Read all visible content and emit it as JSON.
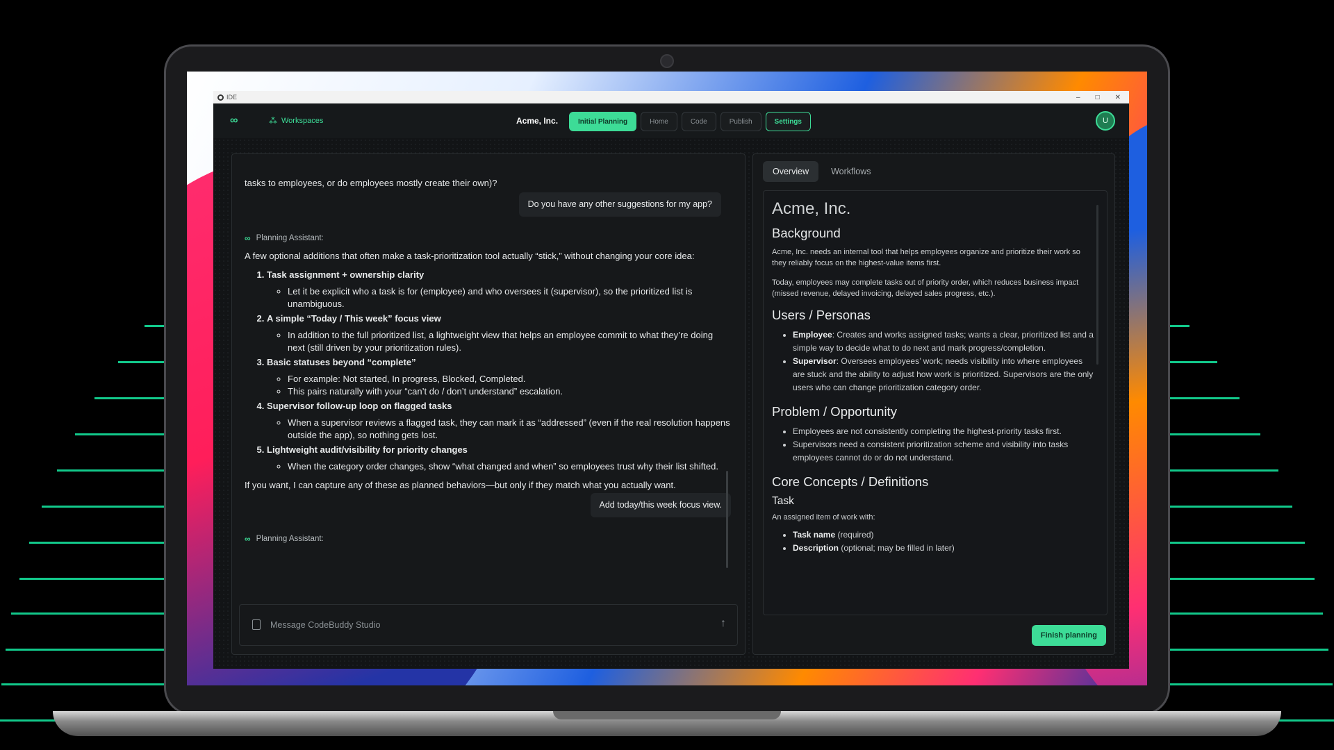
{
  "window": {
    "title": "IDE",
    "controls": [
      "–",
      "□",
      "✕"
    ]
  },
  "appbar": {
    "workspaces_label": "Workspaces",
    "company": "Acme, Inc.",
    "tabs": [
      {
        "label": "Initial Planning"
      },
      {
        "label": "Home"
      },
      {
        "label": "Code"
      },
      {
        "label": "Publish"
      },
      {
        "label": "Settings"
      }
    ],
    "avatar_initial": "U"
  },
  "chat": {
    "top_text": "tasks to employees, or do employees mostly create their own)?",
    "user_message_1": "Do you have any other suggestions for my app?",
    "assistant_label": "Planning Assistant:",
    "intro": "A few optional additions that often make a task-prioritization tool actually “stick,” without changing your core idea:",
    "suggestions": [
      {
        "title": "Task assignment + ownership clarity",
        "bullets": [
          "Let it be explicit who a task is for (employee) and who oversees it (supervisor), so the prioritized list is unambiguous."
        ]
      },
      {
        "title": "A simple “Today / This week” focus view",
        "bullets": [
          "In addition to the full prioritized list, a lightweight view that helps an employee commit to what they’re doing next (still driven by your prioritization rules)."
        ]
      },
      {
        "title": "Basic statuses beyond “complete”",
        "bullets": [
          "For example: Not started, In progress, Blocked, Completed.",
          "This pairs naturally with your “can’t do / don’t understand” escalation."
        ]
      },
      {
        "title": "Supervisor follow-up loop on flagged tasks",
        "bullets": [
          "When a supervisor reviews a flagged task, they can mark it as “addressed” (even if the real resolution happens outside the app), so nothing gets lost."
        ]
      },
      {
        "title": "Lightweight audit/visibility for priority changes",
        "bullets": [
          "When the category order changes, show “what changed and when” so employees trust why their list shifted."
        ]
      }
    ],
    "outro": "If you want, I can capture any of these as planned behaviors—but only if they match what you actually want.",
    "user_message_2": "Add today/this week focus view.",
    "assistant_label_2": "Planning Assistant:",
    "input_placeholder": "Message CodeBuddy Studio"
  },
  "panel": {
    "tabs": [
      {
        "label": "Overview"
      },
      {
        "label": "Workflows"
      }
    ],
    "doc": {
      "title": "Acme, Inc.",
      "background_heading": "Background",
      "background_p1": "Acme, Inc. needs an internal tool that helps employees organize and prioritize their work so they reliably focus on the highest-value items first.",
      "background_p2": "Today, employees may complete tasks out of priority order, which reduces business impact (missed revenue, delayed invoicing, delayed sales progress, etc.).",
      "users_heading": "Users / Personas",
      "personas": [
        {
          "name": "Employee",
          "text": ": Creates and works assigned tasks; wants a clear, prioritized list and a simple way to decide what to do next and mark progress/completion."
        },
        {
          "name": "Supervisor",
          "text": ": Oversees employees’ work; needs visibility into where employees are stuck and the ability to adjust how work is prioritized. Supervisors are the only users who can change prioritization category order."
        }
      ],
      "problem_heading": "Problem / Opportunity",
      "problems": [
        "Employees are not consistently completing the highest-priority tasks first.",
        "Supervisors need a consistent prioritization scheme and visibility into tasks employees cannot do or do not understand."
      ],
      "concepts_heading": "Core Concepts / Definitions",
      "task_heading": "Task",
      "task_desc": "An assigned item of work with:",
      "task_fields": [
        {
          "name": "Task name",
          "text": " (required)"
        },
        {
          "name": "Description",
          "text": " (optional; may be filled in later)"
        }
      ]
    },
    "finish_label": "Finish planning"
  },
  "colors": {
    "accent": "#3ddc97",
    "app_bg": "#101214",
    "panel_bg": "#16181a"
  }
}
